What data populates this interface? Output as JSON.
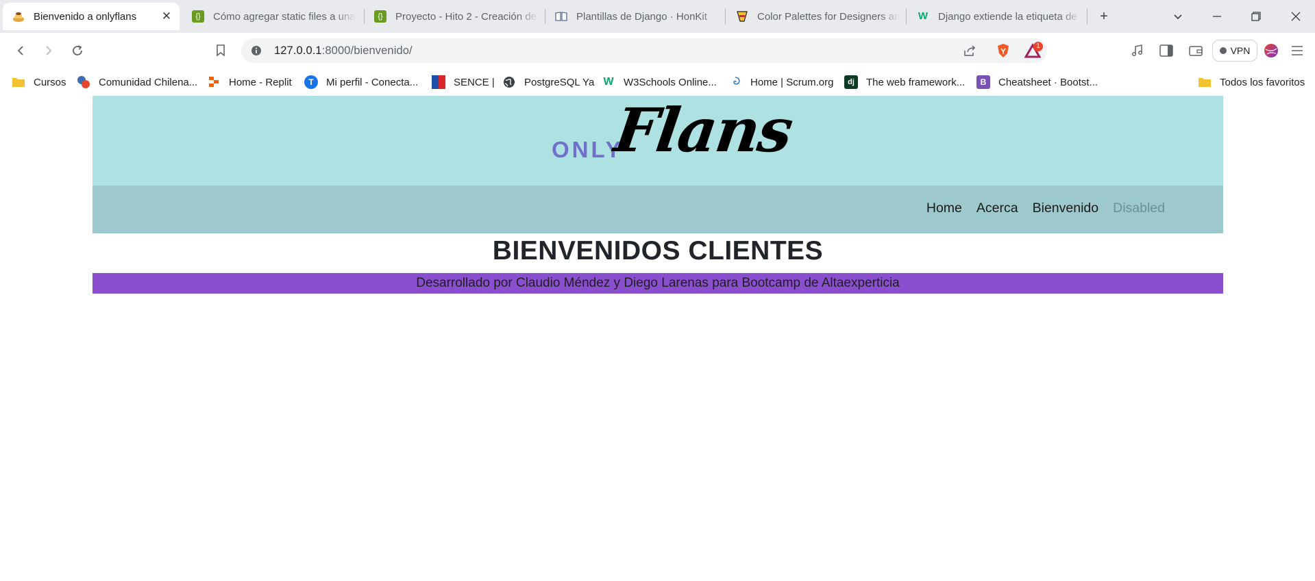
{
  "browser": {
    "tabs": [
      {
        "title": "Bienvenido a onlyflans",
        "icon": "flan-icon",
        "active": true
      },
      {
        "title": "Cómo agregar static files a una",
        "icon": "code-brackets-icon",
        "active": false
      },
      {
        "title": "Proyecto - Hito 2 - Creación de",
        "icon": "code-brackets-icon",
        "active": false
      },
      {
        "title": "Plantillas de Django · HonKit",
        "icon": "book-icon",
        "active": false
      },
      {
        "title": "Color Palettes for Designers an",
        "icon": "palette-icon",
        "active": false
      },
      {
        "title": "Django extiende la etiqueta de",
        "icon": "w3-icon",
        "active": false
      }
    ],
    "tab_close_glyph": "✕",
    "new_tab_glyph": "+",
    "url_host": "127.0.0.1",
    "url_path": ":8000/bienvenido/",
    "notification_count": "1",
    "vpn_label": "VPN",
    "bookmarks": [
      {
        "label": "Cursos",
        "icon": "folder-icon"
      },
      {
        "label": "Comunidad Chilena...",
        "icon": "python-icon"
      },
      {
        "label": "Home - Replit",
        "icon": "replit-icon"
      },
      {
        "label": "Mi perfil - Conecta...",
        "icon": "t-icon"
      },
      {
        "label": "SENCE |",
        "icon": "sence-icon"
      },
      {
        "label": "PostgreSQL Ya",
        "icon": "globe-icon"
      },
      {
        "label": "W3Schools Online...",
        "icon": "w3-icon"
      },
      {
        "label": "Home | Scrum.org",
        "icon": "scrum-icon"
      },
      {
        "label": "The web framework...",
        "icon": "django-icon"
      },
      {
        "label": "Cheatsheet · Bootst...",
        "icon": "bootstrap-icon"
      }
    ],
    "all_bookmarks_label": "Todos los favoritos",
    "colors": {
      "tabstrip": "#e8eaee",
      "omnibox": "#f1f3f4"
    }
  },
  "site": {
    "logo_small": "ONLY",
    "logo_script": "Flans",
    "nav": [
      {
        "label": "Home",
        "disabled": false
      },
      {
        "label": "Acerca",
        "disabled": false
      },
      {
        "label": "Bienvenido",
        "disabled": false
      },
      {
        "label": "Disabled",
        "disabled": true
      }
    ],
    "heading": "BIENVENIDOS CLIENTES",
    "footer": "Desarrollado por Claudio Méndez y Diego Larenas para Bootcamp de Altaexperticia",
    "colors": {
      "hero": "#aee2e2",
      "navbar": "#9dc8cc",
      "footer": "#8a4fcf",
      "logo_only": "#7070cc"
    }
  }
}
